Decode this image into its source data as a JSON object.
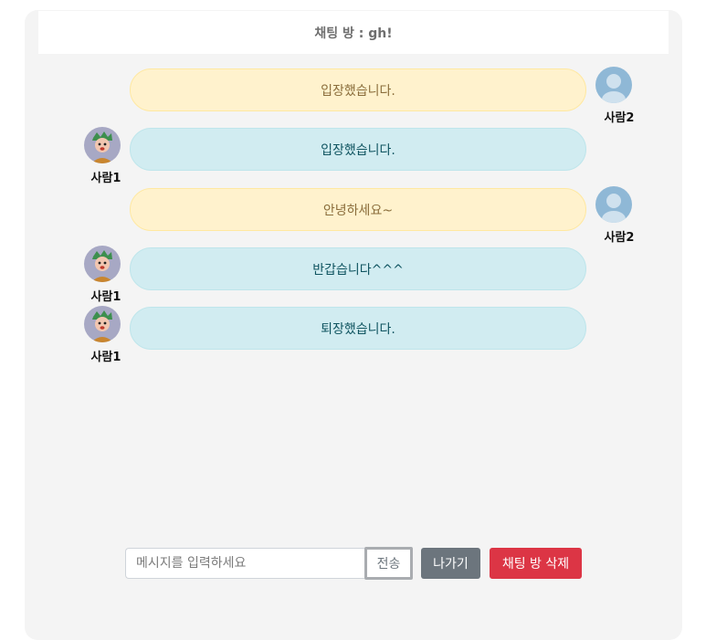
{
  "room": {
    "title": "채팅 방 : gh!"
  },
  "messages": [
    {
      "text": "입장했습니다.",
      "sender": "사람2",
      "side": "right",
      "style": "yellow",
      "avatar": "default-user-icon"
    },
    {
      "text": "입장했습니다.",
      "sender": "사람1",
      "side": "left",
      "style": "blue",
      "avatar": "cartoon-avatar"
    },
    {
      "text": "안녕하세요~",
      "sender": "사람2",
      "side": "right",
      "style": "yellow",
      "avatar": "default-user-icon"
    },
    {
      "text": "반갑습니다^^^",
      "sender": "사람1",
      "side": "left",
      "style": "blue",
      "avatar": "cartoon-avatar"
    },
    {
      "text": "퇴장했습니다.",
      "sender": "사람1",
      "side": "left",
      "style": "blue",
      "avatar": "cartoon-avatar"
    }
  ],
  "composer": {
    "placeholder": "메시지를 입력하세요",
    "value": "",
    "send_label": "전송",
    "leave_label": "나가기",
    "delete_label": "채팅 방 삭제"
  },
  "colors": {
    "own_bubble": "#fff2cd",
    "other_bubble": "#d1ecf1",
    "leave_button": "#6c757d",
    "delete_button": "#dc3545",
    "panel_background": "#f4f4f4"
  }
}
